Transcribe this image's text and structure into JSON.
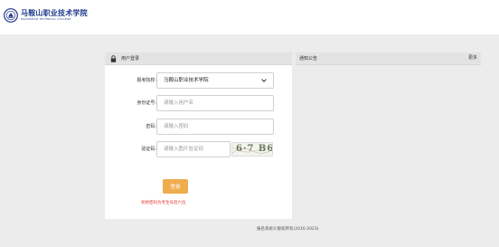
{
  "header": {
    "logo_cn": "马鞍山职业技术学院",
    "logo_en": "MAANSHAN TECHNICAL COLLEGE"
  },
  "login": {
    "title": "用户登录",
    "school_label": "报考院校:",
    "school_value": "马鞍山职业技术学院",
    "id_label": "身份证号:",
    "id_placeholder": "请输入用户名",
    "password_label": "密码:",
    "password_placeholder": "请输入密码",
    "captcha_label": "验证码:",
    "captcha_placeholder": "请输入图片验证码",
    "captcha_text": "6·7 B6",
    "submit_label": "登录",
    "hint": "初始密码为考生号后六位"
  },
  "notice": {
    "title": "通知公告",
    "more_label": "更多"
  },
  "footer": {
    "copyright": "报名系统©版权所有(2016-2023)"
  },
  "colors": {
    "brand": "#1e3a8a",
    "button": "#f0ad4e",
    "hint": "#e53935"
  },
  "icons": [
    "school-seal-icon",
    "lock-icon",
    "chevron-down-icon"
  ]
}
